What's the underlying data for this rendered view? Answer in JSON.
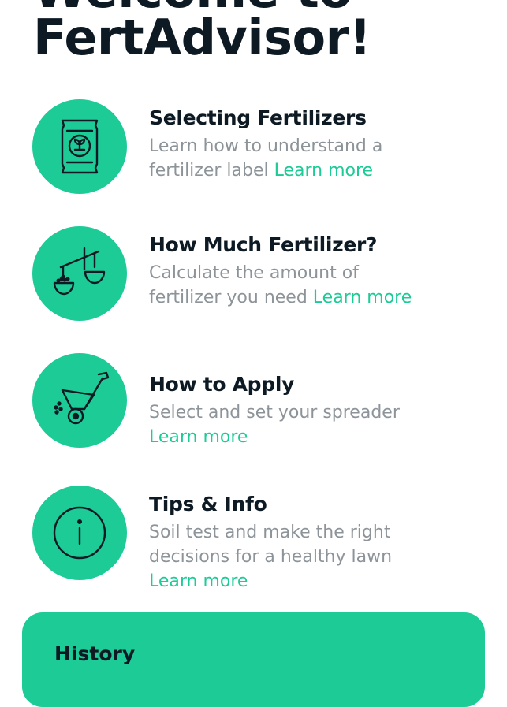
{
  "header": {
    "title_line1": "Welcome to",
    "title_line2": "FertAdvisor!"
  },
  "items": [
    {
      "icon": "fertilizer-bag-icon",
      "title": "Selecting Fertilizers",
      "desc_line1": "Learn how to understand a",
      "desc_line2": "fertilizer label ",
      "learn_more": "Learn more"
    },
    {
      "icon": "scale-icon",
      "title": "How Much Fertilizer?",
      "desc_line1": "Calculate the amount of",
      "desc_line2": "fertilizer you need ",
      "learn_more": "Learn more"
    },
    {
      "icon": "spreader-icon",
      "title": "How to Apply",
      "desc_line1": "Select and set your spreader",
      "learn_more": "Learn more"
    },
    {
      "icon": "info-icon",
      "title": "Tips & Info",
      "desc_line1": "Soil test and make the right",
      "desc_line2": "decisions for a healthy lawn",
      "learn_more": "Learn more"
    }
  ],
  "history": {
    "label": "History"
  },
  "colors": {
    "accent": "#1ccb96",
    "text_dark": "#0d1a24",
    "text_muted": "#8d9499",
    "background": "#ffffff"
  }
}
